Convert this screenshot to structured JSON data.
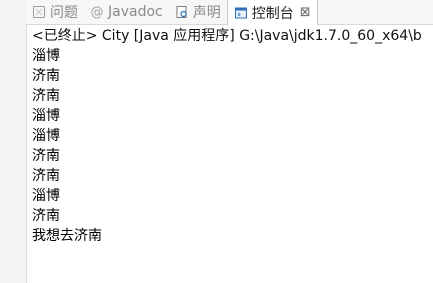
{
  "tabs": [
    {
      "label": "问题",
      "icon": "problems-icon",
      "active": false
    },
    {
      "label": "Javadoc",
      "icon": "javadoc-icon",
      "active": false
    },
    {
      "label": "声明",
      "icon": "declaration-icon",
      "active": false
    },
    {
      "label": "控制台",
      "icon": "console-icon",
      "active": true,
      "close_glyph": "⊠"
    }
  ],
  "console": {
    "status": "<已终止> City [Java 应用程序] G:\\Java\\jdk1.7.0_60_x64\\b",
    "lines": [
      "淄博",
      "济南",
      "济南",
      "淄博",
      "淄博",
      "济南",
      "济南",
      "淄博",
      "济南",
      "我想去济南"
    ]
  },
  "colors": {
    "accent_blue": "#2f6fb5",
    "icon_gray": "#9a9a9a"
  }
}
